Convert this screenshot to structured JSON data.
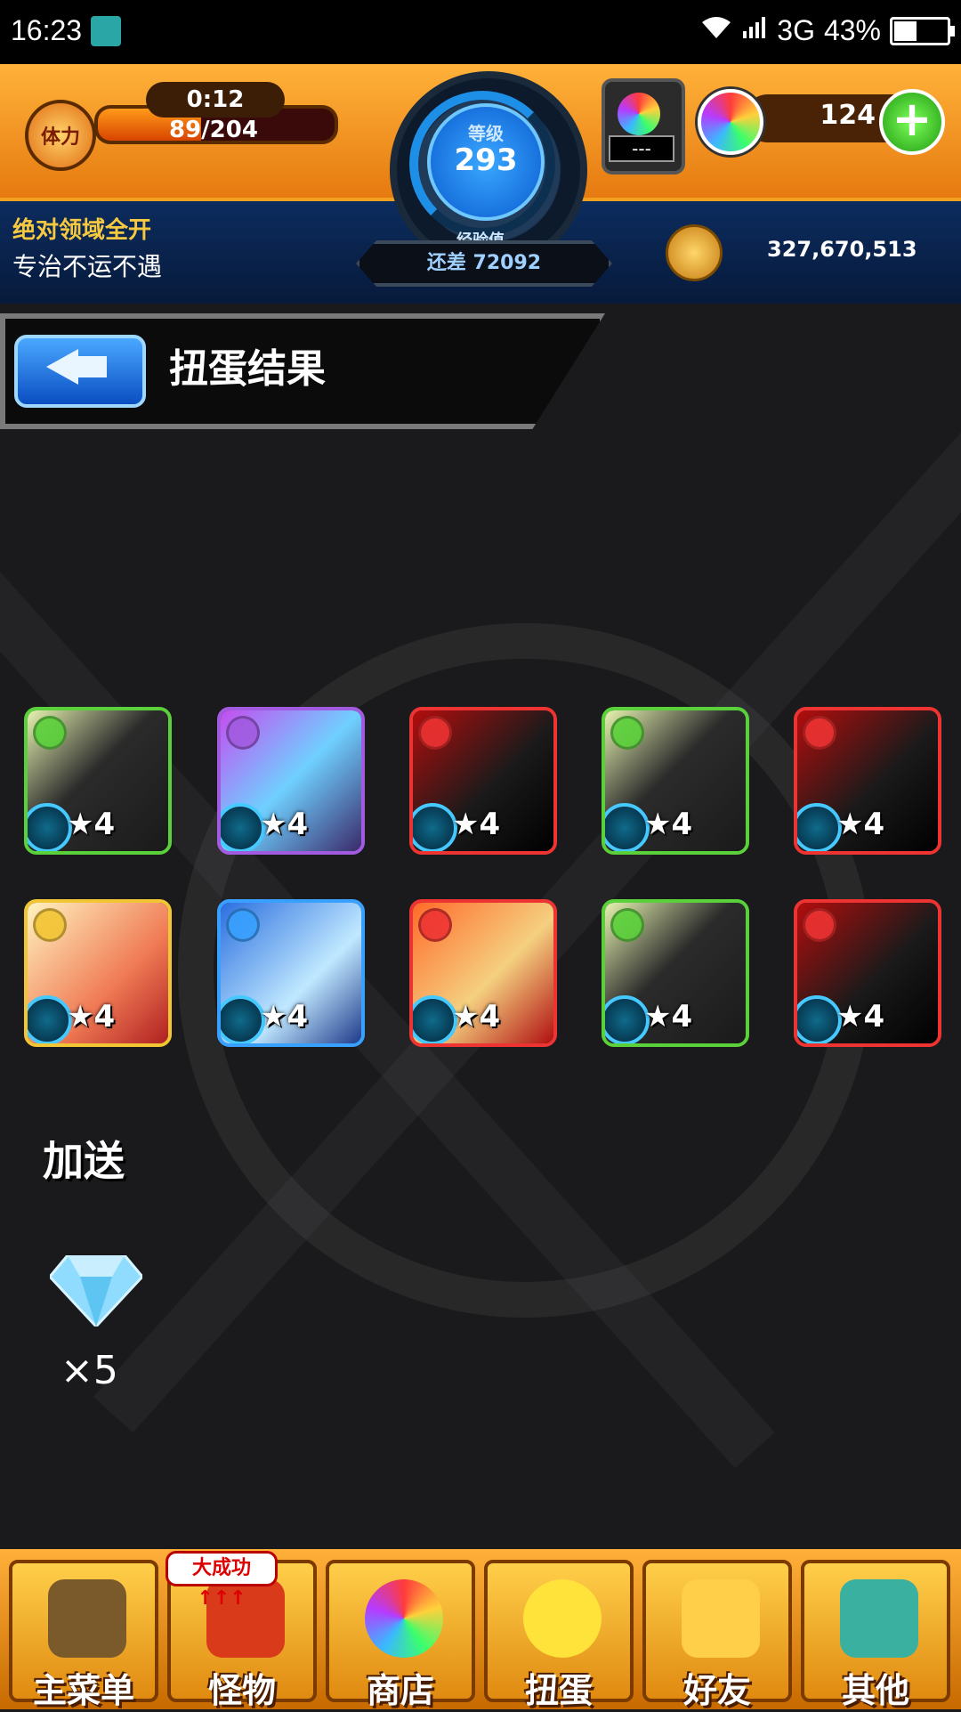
{
  "status_bar": {
    "time": "16:23",
    "network": "3G",
    "battery": "43%",
    "battery_level": 0.43
  },
  "stamina": {
    "label": "体力",
    "timer": "0:12",
    "value": "89/204",
    "fill": 0.436
  },
  "level": {
    "label": "等级",
    "value": "293",
    "exp_label": "经验值",
    "exp_remaining": "还差 72092"
  },
  "egg_counter": "---",
  "orbs": {
    "count": "124",
    "plus": "+"
  },
  "player": {
    "title": "绝对领域全开",
    "subtitle": "专治不运不遇",
    "coins": "327,670,513"
  },
  "header": {
    "title": "扭蛋结果"
  },
  "results": [
    {
      "stars": "★4",
      "element": "wood",
      "character": "black-cat"
    },
    {
      "stars": "★4",
      "element": "dark",
      "character": "masked-blue-hair-girl"
    },
    {
      "stars": "★4",
      "element": "fire",
      "character": "red-hair-goggles-man"
    },
    {
      "stars": "★4",
      "element": "wood",
      "character": "black-cat"
    },
    {
      "stars": "★4",
      "element": "fire",
      "character": "red-hair-goggles-man"
    },
    {
      "stars": "★4",
      "element": "light",
      "character": "white-hair-girl"
    },
    {
      "stars": "★4",
      "element": "water",
      "character": "blue-hair-woman"
    },
    {
      "stars": "★4",
      "element": "fire",
      "character": "red-hair-kid"
    },
    {
      "stars": "★4",
      "element": "wood",
      "character": "black-cat"
    },
    {
      "stars": "★4",
      "element": "fire",
      "character": "red-hair-goggles-man"
    }
  ],
  "bonus": {
    "label": "加送",
    "item": "gem-icon",
    "count": "×5"
  },
  "nav": {
    "badge": "大成功↑↑↑",
    "items": [
      {
        "label": "主菜单",
        "icon": "castle-gate-icon"
      },
      {
        "label": "怪物",
        "icon": "dragon-monster-icon"
      },
      {
        "label": "商店",
        "icon": "rainbow-orb-icon"
      },
      {
        "label": "扭蛋",
        "icon": "egg-icon"
      },
      {
        "label": "好友",
        "icon": "friends-icon"
      },
      {
        "label": "其他",
        "icon": "question-key-icon"
      }
    ]
  },
  "colors": {
    "fire": "#d81f1f",
    "water": "#1f7fd8",
    "wood": "#3bb33b",
    "light": "#e0b020",
    "dark": "#8a3bd8"
  }
}
